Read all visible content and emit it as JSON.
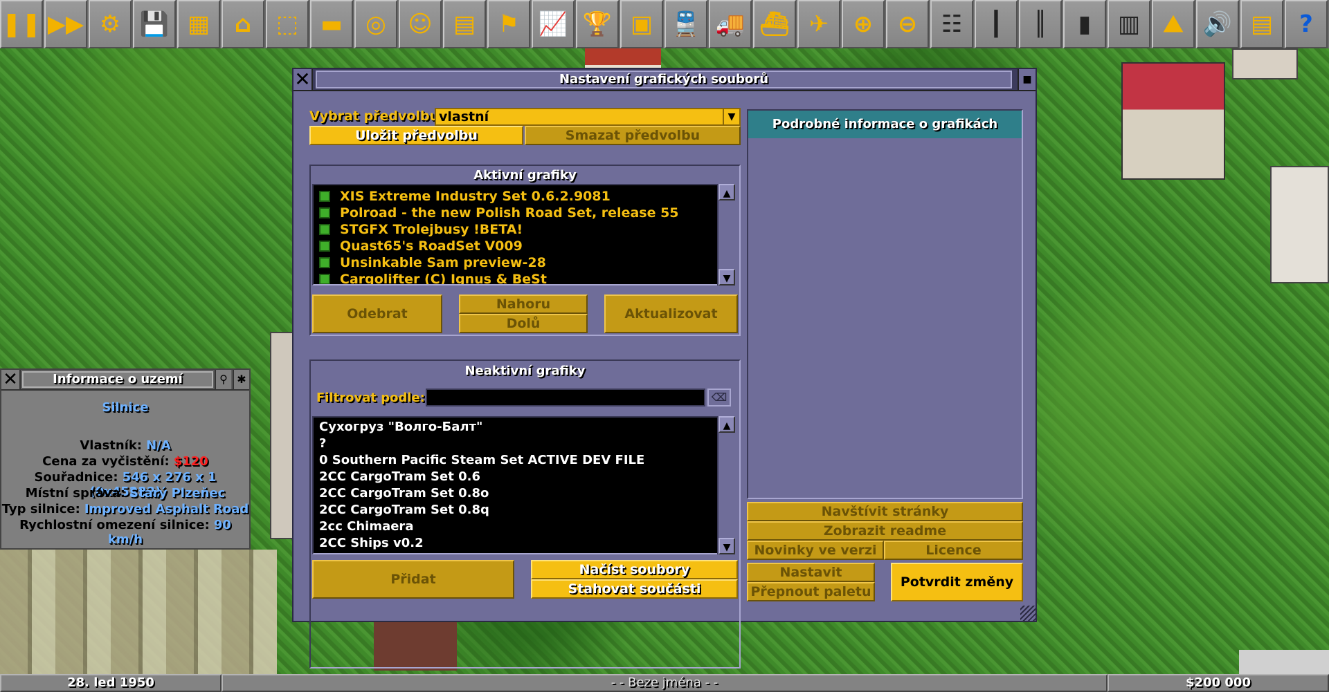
{
  "toolbar": {
    "buttons": [
      {
        "name": "pause-button",
        "icon": "pause-icon",
        "glyph": "❚❚"
      },
      {
        "name": "fast-forward-button",
        "icon": "fast-forward-icon",
        "glyph": "▶▶"
      },
      {
        "name": "settings-button",
        "icon": "gear-icon",
        "glyph": "⚙"
      },
      {
        "name": "save-button",
        "icon": "floppy-disk-icon",
        "glyph": "💾"
      },
      {
        "name": "map-button",
        "icon": "map-icon",
        "glyph": "▦"
      },
      {
        "name": "town-directory-button",
        "icon": "town-icon",
        "glyph": "⌂"
      },
      {
        "name": "subsidies-button",
        "icon": "subsidies-icon",
        "glyph": "⬚"
      },
      {
        "name": "stations-button",
        "icon": "station-icon",
        "glyph": "▬"
      },
      {
        "name": "finances-button",
        "icon": "coins-icon",
        "glyph": "◎"
      },
      {
        "name": "company-button",
        "icon": "manager-face-icon",
        "glyph": "☺"
      },
      {
        "name": "story-book-button",
        "icon": "book-icon",
        "glyph": "▤"
      },
      {
        "name": "goals-button",
        "icon": "flag-icon",
        "glyph": "⚑"
      },
      {
        "name": "graphs-button",
        "icon": "graph-icon",
        "glyph": "📈"
      },
      {
        "name": "league-table-button",
        "icon": "trophy-icon",
        "glyph": "🏆"
      },
      {
        "name": "industries-button",
        "icon": "factory-icon",
        "glyph": "▣"
      },
      {
        "name": "trains-button",
        "icon": "train-icon",
        "glyph": "🚆"
      },
      {
        "name": "road-vehicles-button",
        "icon": "truck-icon",
        "glyph": "🚚"
      },
      {
        "name": "ships-button",
        "icon": "ship-icon",
        "glyph": "⛴"
      },
      {
        "name": "aircraft-button",
        "icon": "aircraft-icon",
        "glyph": "✈"
      },
      {
        "name": "zoom-in-button",
        "icon": "zoom-in-icon",
        "glyph": "⊕"
      },
      {
        "name": "zoom-out-button",
        "icon": "zoom-out-icon",
        "glyph": "⊖"
      },
      {
        "name": "build-railway-button",
        "icon": "railway-track-icon",
        "glyph": "☷"
      },
      {
        "name": "build-road-button",
        "icon": "road-icon",
        "glyph": "┃"
      },
      {
        "name": "build-tramway-button",
        "icon": "tramway-icon",
        "glyph": "║"
      },
      {
        "name": "build-waterways-button",
        "icon": "waterway-icon",
        "glyph": "▮"
      },
      {
        "name": "build-airport-button",
        "icon": "runway-icon",
        "glyph": "▥"
      },
      {
        "name": "landscaping-button",
        "icon": "landscape-icon",
        "glyph": "⛰"
      },
      {
        "name": "music-button",
        "icon": "speaker-icon",
        "glyph": "🔊"
      },
      {
        "name": "news-button",
        "icon": "newspaper-icon",
        "glyph": "▤"
      },
      {
        "name": "help-button",
        "icon": "help-icon",
        "glyph": "?"
      }
    ]
  },
  "newgrf_window": {
    "title": "Nastavení grafických souborů",
    "preset_label": "Vybrat předvolbu:",
    "preset_value": "vlastní",
    "save_preset": "Uložit předvolbu",
    "delete_preset": "Smazat předvolbu",
    "active_header": "Aktivní grafiky",
    "active_items": [
      "XIS Extreme Industry Set 0.6.2.9081",
      "Polroad - the new Polish Road Set, release 55",
      "STGFX Trolejbusy !BETA!",
      "Quast65's RoadSet V009",
      "Unsinkable Sam preview-28",
      "Cargolifter (C) Ignus & BeSt"
    ],
    "remove": "Odebrat",
    "move_up": "Nahoru",
    "move_down": "Dolů",
    "update": "Aktualizovat",
    "inactive_header": "Neaktivní grafiky",
    "filter_label": "Filtrovat podle:",
    "filter_value": "",
    "inactive_items": [
      "Сухогруз \"Волго-Балт\"",
      "?",
      "0 Southern Pacific Steam Set ACTIVE DEV FILE",
      "2CC CargoTram Set 0.6",
      "2CC CargoTram Set 0.8o",
      "2CC CargoTram Set 0.8q",
      "2cc Chimaera",
      "2CC Ships v0.2"
    ],
    "add": "Přidat",
    "rescan": "Načíst soubory",
    "download": "Stahovat součásti",
    "details_header": "Podrobné informace o grafikách",
    "visit_website": "Navštívit stránky",
    "view_readme": "Zobrazit readme",
    "changelog": "Novinky ve verzi",
    "license": "Licence",
    "set_parameters": "Nastavit parametry",
    "toggle_palette": "Přepnout paletu",
    "apply": "Potvrdit změny"
  },
  "land_info": {
    "title": "Informace o uzemí",
    "terrain": "Silnice",
    "rows": [
      {
        "label": "Vlastník:",
        "value": "N/A",
        "color": "#6fb2ff"
      },
      {
        "label": "Cena za vyčistění:",
        "value": "$120",
        "color": "#ff2020"
      },
      {
        "label": "Souřadnice:",
        "value": "546 x 276 x 1 (0x45222)",
        "color": "#6fb2ff"
      },
      {
        "label": "Místní správa:",
        "value": "Starý Plzeňec",
        "color": "#6fb2ff"
      },
      {
        "label": "Typ silnice:",
        "value": "Improved Asphalt Road",
        "color": "#6fb2ff"
      },
      {
        "label": "Rychlostní omezení silnice:",
        "value": "90 km/h",
        "color": "#6fb2ff"
      }
    ]
  },
  "status_bar": {
    "date": "28. led 1950",
    "company": "- -  Beze jména  - -",
    "money": "$200 000"
  },
  "colors": {
    "window_bg": "#6f6d99",
    "gold": "#c49a16",
    "gold_bright": "#f5bf12",
    "details_header_bg": "#2f7f8a",
    "grass": "#438f2d"
  }
}
